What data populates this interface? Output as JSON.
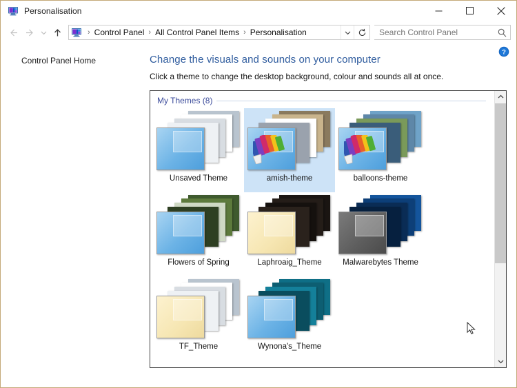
{
  "window": {
    "title": "Personalisation",
    "title_icon": "personalisation-monitor-icon",
    "minimize_label": "—",
    "maximize_label": "□",
    "close_label": "✕"
  },
  "nav": {
    "back_label": "←",
    "forward_label": "→",
    "recent_label": "⌄",
    "up_label": "↑",
    "address_icon": "personalisation-monitor-icon",
    "breadcrumbs": [
      {
        "label": "Control Panel"
      },
      {
        "label": "All Control Panel Items"
      },
      {
        "label": "Personalisation"
      }
    ],
    "separator": "›",
    "dropdown_label": "⌄",
    "refresh_label": "↻"
  },
  "search": {
    "placeholder": "Search Control Panel",
    "value": "",
    "icon": "search-icon"
  },
  "sidebar": {
    "items": [
      {
        "label": "Control Panel Home"
      }
    ]
  },
  "main": {
    "help_icon": "help-question-icon",
    "heading": "Change the visuals and sounds on your computer",
    "subheading": "Click a theme to change the desktop background, colour and sounds all at once.",
    "group_label": "My Themes (8)",
    "themes": [
      {
        "label": "Unsaved Theme",
        "selected": false,
        "window_color": "blue",
        "has_palette": false,
        "stack": [
          "#b9c4cf",
          "#ffffff",
          "#d8dde2",
          "#eef1f4"
        ]
      },
      {
        "label": "amish-theme",
        "selected": true,
        "window_color": "blue",
        "has_palette": true,
        "stack": [
          "#8a7a5e",
          "#c9b48c",
          "#ffffff",
          "#9aa2ad"
        ]
      },
      {
        "label": "balloons-theme",
        "selected": false,
        "window_color": "blue",
        "has_palette": true,
        "stack": [
          "#6fa3c8",
          "#5e87a8",
          "#7a9a5a",
          "#3a5d7a"
        ]
      },
      {
        "label": "Flowers of Spring",
        "selected": false,
        "window_color": "blue",
        "has_palette": false,
        "stack": [
          "#3f5a2e",
          "#5d7a3c",
          "#cfd9c4",
          "#2e3f22"
        ]
      },
      {
        "label": "Laphroaig_Theme",
        "selected": false,
        "window_color": "cream",
        "has_palette": false,
        "stack": [
          "#1a1512",
          "#241d18",
          "#15110e",
          "#2a221c"
        ]
      },
      {
        "label": "Malwarebytes Theme",
        "selected": false,
        "window_color": "grey",
        "has_palette": false,
        "stack": [
          "#14559c",
          "#0d3f78",
          "#0a2c55",
          "#06203f"
        ]
      },
      {
        "label": "TF_Theme",
        "selected": false,
        "window_color": "cream",
        "has_palette": false,
        "stack": [
          "#b9c4cf",
          "#ffffff",
          "#d8dde2",
          "#eef1f4"
        ]
      },
      {
        "label": "Wynona's_Theme",
        "selected": false,
        "window_color": "blue",
        "has_palette": false,
        "stack": [
          "#0f6f86",
          "#0d5e72",
          "#14809a",
          "#0a4d5e"
        ]
      }
    ]
  },
  "scrollbar": {
    "up_label": "⌃",
    "down_label": "⌄"
  },
  "colors": {
    "accent_heading": "#2f5c9e",
    "group_label": "#3a4a9a",
    "selection": "#cde3f7",
    "window_border": "#c4a878"
  }
}
